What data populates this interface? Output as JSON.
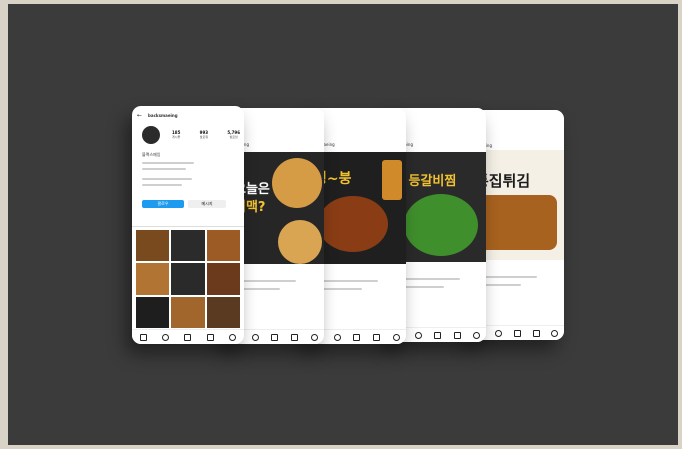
{
  "profile": {
    "username": "backsmaeing",
    "stats": [
      {
        "value": "185",
        "label": "게시물"
      },
      {
        "value": "993",
        "label": "팔로워"
      },
      {
        "value": "5,796",
        "label": "팔로잉"
      }
    ],
    "name": "블랙스매잉",
    "follow_label": "팔로우",
    "message_label": "메시지"
  },
  "posts": [
    {
      "user": "maeing",
      "headline": "오늘은",
      "headline2": "피맥?"
    },
    {
      "user": "bimaeing",
      "headline": "칭~붕"
    },
    {
      "user": "maeing",
      "headline": "로 등갈비찜"
    },
    {
      "user": "maeing",
      "headline": "통집튀김"
    }
  ],
  "colors": {
    "background": "#3b3b3b",
    "accent_yellow": "#f2c230",
    "follow_blue": "#1d9bf0"
  }
}
